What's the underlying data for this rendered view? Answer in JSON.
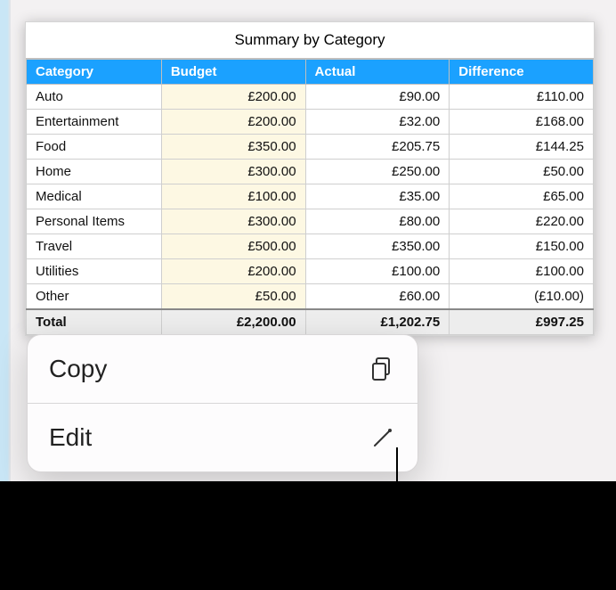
{
  "sheet": {
    "title": "Summary by Category",
    "headers": {
      "category": "Category",
      "budget": "Budget",
      "actual": "Actual",
      "difference": "Difference"
    },
    "rows": [
      {
        "category": "Auto",
        "budget": "£200.00",
        "actual": "£90.00",
        "difference": "£110.00"
      },
      {
        "category": "Entertainment",
        "budget": "£200.00",
        "actual": "£32.00",
        "difference": "£168.00"
      },
      {
        "category": "Food",
        "budget": "£350.00",
        "actual": "£205.75",
        "difference": "£144.25"
      },
      {
        "category": "Home",
        "budget": "£300.00",
        "actual": "£250.00",
        "difference": "£50.00"
      },
      {
        "category": "Medical",
        "budget": "£100.00",
        "actual": "£35.00",
        "difference": "£65.00"
      },
      {
        "category": "Personal Items",
        "budget": "£300.00",
        "actual": "£80.00",
        "difference": "£220.00"
      },
      {
        "category": "Travel",
        "budget": "£500.00",
        "actual": "£350.00",
        "difference": "£150.00"
      },
      {
        "category": "Utilities",
        "budget": "£200.00",
        "actual": "£100.00",
        "difference": "£100.00"
      },
      {
        "category": "Other",
        "budget": "£50.00",
        "actual": "£60.00",
        "difference": "(£10.00)",
        "negative": true
      }
    ],
    "total": {
      "label": "Total",
      "budget": "£2,200.00",
      "actual": "£1,202.75",
      "difference": "£997.25"
    }
  },
  "menu": {
    "copy_label": "Copy",
    "edit_label": "Edit"
  }
}
